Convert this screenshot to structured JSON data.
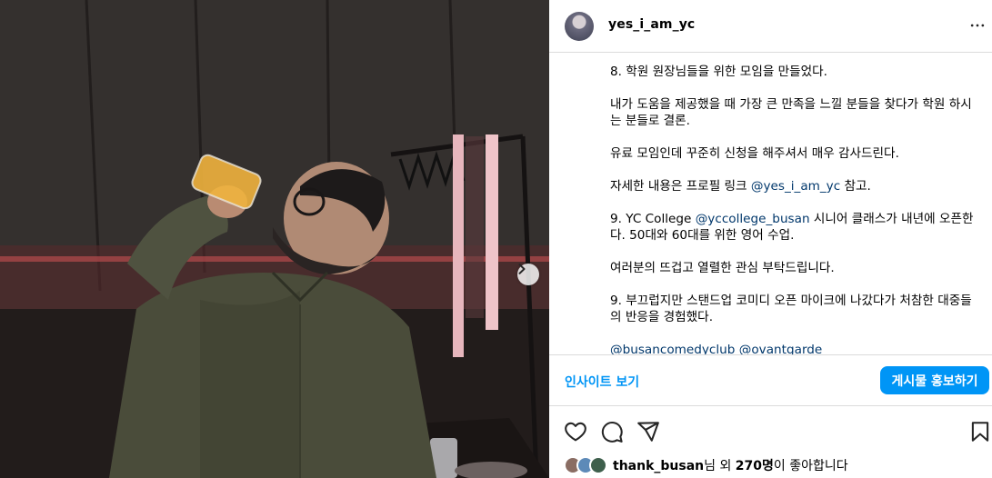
{
  "post": {
    "username": "yes_i_am_yc",
    "caption": [
      {
        "parts": [
          {
            "t": "8. 학원 원장님들을 위한 모임을 만들었다."
          }
        ]
      },
      {
        "parts": [
          {
            "t": "내가 도움을 제공했을 때 가장 큰 만족을 느낄 분들을 찾다가 학원 하시는 분들로 결론."
          }
        ]
      },
      {
        "parts": [
          {
            "t": "유료 모임인데 꾸준히 신청을 해주셔서 매우 감사드린다."
          }
        ]
      },
      {
        "parts": [
          {
            "t": "자세한 내용은 프로필 링크 "
          },
          {
            "t": "@yes_i_am_yc",
            "mention": true
          },
          {
            "t": " 참고."
          }
        ]
      },
      {
        "parts": [
          {
            "t": "9. YC College "
          },
          {
            "t": "@yccollege_busan",
            "mention": true
          },
          {
            "t": " 시니어 클래스가 내년에 오픈한다. 50대와 60대를 위한 영어 수업."
          }
        ]
      },
      {
        "parts": [
          {
            "t": "여러분의 뜨겁고 열렬한 관심 부탁드립니다."
          }
        ]
      },
      {
        "parts": [
          {
            "t": "9. 부끄럽지만 스탠드업 코미디 오픈 마이크에 나갔다가 처참한 대중들의 반응을 경험했다."
          }
        ]
      },
      {
        "parts": [
          {
            "t": "@busancomedyclub",
            "mention": true
          },
          {
            "t": " "
          },
          {
            "t": "@ovantgarde",
            "mention": true
          }
        ]
      }
    ],
    "insight_label": "인사이트 보기",
    "boost_label": "게시물 홍보하기",
    "likes": {
      "user": "thank_busan",
      "mid": "님 외 ",
      "count": "270명",
      "tail": "이 좋아합니다"
    }
  },
  "icons": {
    "more": "more-horizontal-icon",
    "like": "heart-icon",
    "comment": "comment-icon",
    "share": "share-icon",
    "save": "bookmark-icon",
    "next": "chevron-right-icon"
  },
  "colors": {
    "accent": "#0095f6",
    "mention": "#00376b",
    "divider": "#dbdbdb"
  }
}
